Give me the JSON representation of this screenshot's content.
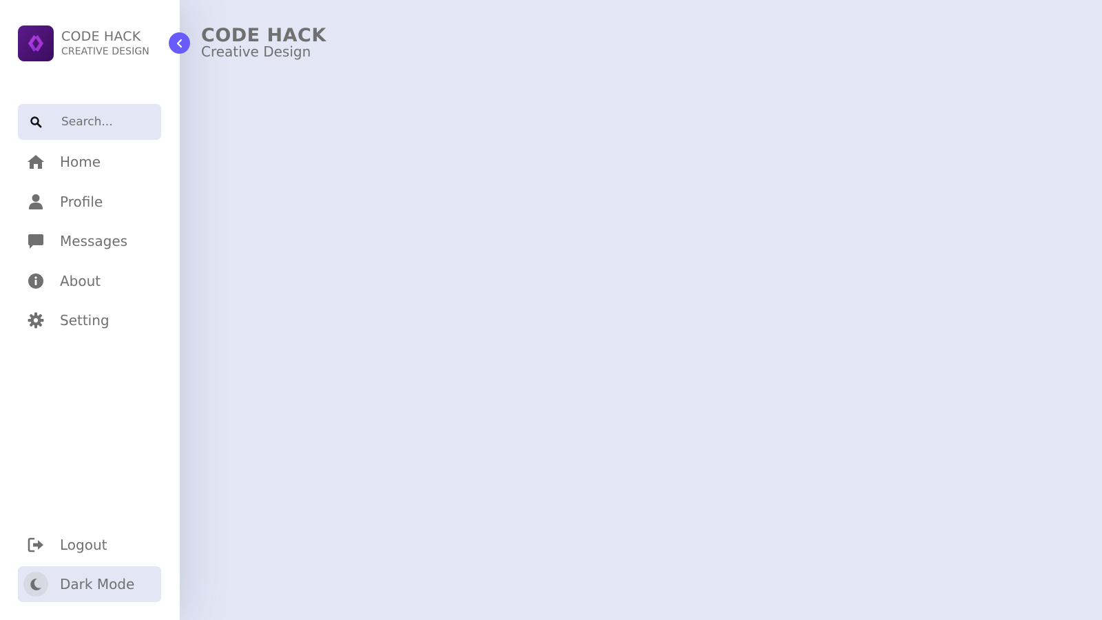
{
  "brand": {
    "name": "CODE HACK",
    "tagline": "CREATIVE DESIGN",
    "logo_icon": "code-hack-logo-icon"
  },
  "toggle": {
    "icon": "chevron-left-icon"
  },
  "search": {
    "placeholder": "Search...",
    "value": "",
    "icon": "search-icon"
  },
  "menu": {
    "items": [
      {
        "label": "Home",
        "icon": "home-icon"
      },
      {
        "label": "Profile",
        "icon": "user-icon"
      },
      {
        "label": "Messages",
        "icon": "message-icon"
      },
      {
        "label": "About",
        "icon": "info-icon"
      },
      {
        "label": "Setting",
        "icon": "gear-icon"
      }
    ]
  },
  "bottom": {
    "logout_label": "Logout",
    "logout_icon": "logout-icon",
    "dark_mode_label": "Dark Mode",
    "dark_mode_icon": "moon-icon"
  },
  "main": {
    "title": "CODE HACK",
    "subtitle": "Creative Design"
  },
  "colors": {
    "accent": "#695cfe",
    "text": "#707070",
    "body_background": "#e3e7f5",
    "sidebar_background": "#ffffff"
  }
}
